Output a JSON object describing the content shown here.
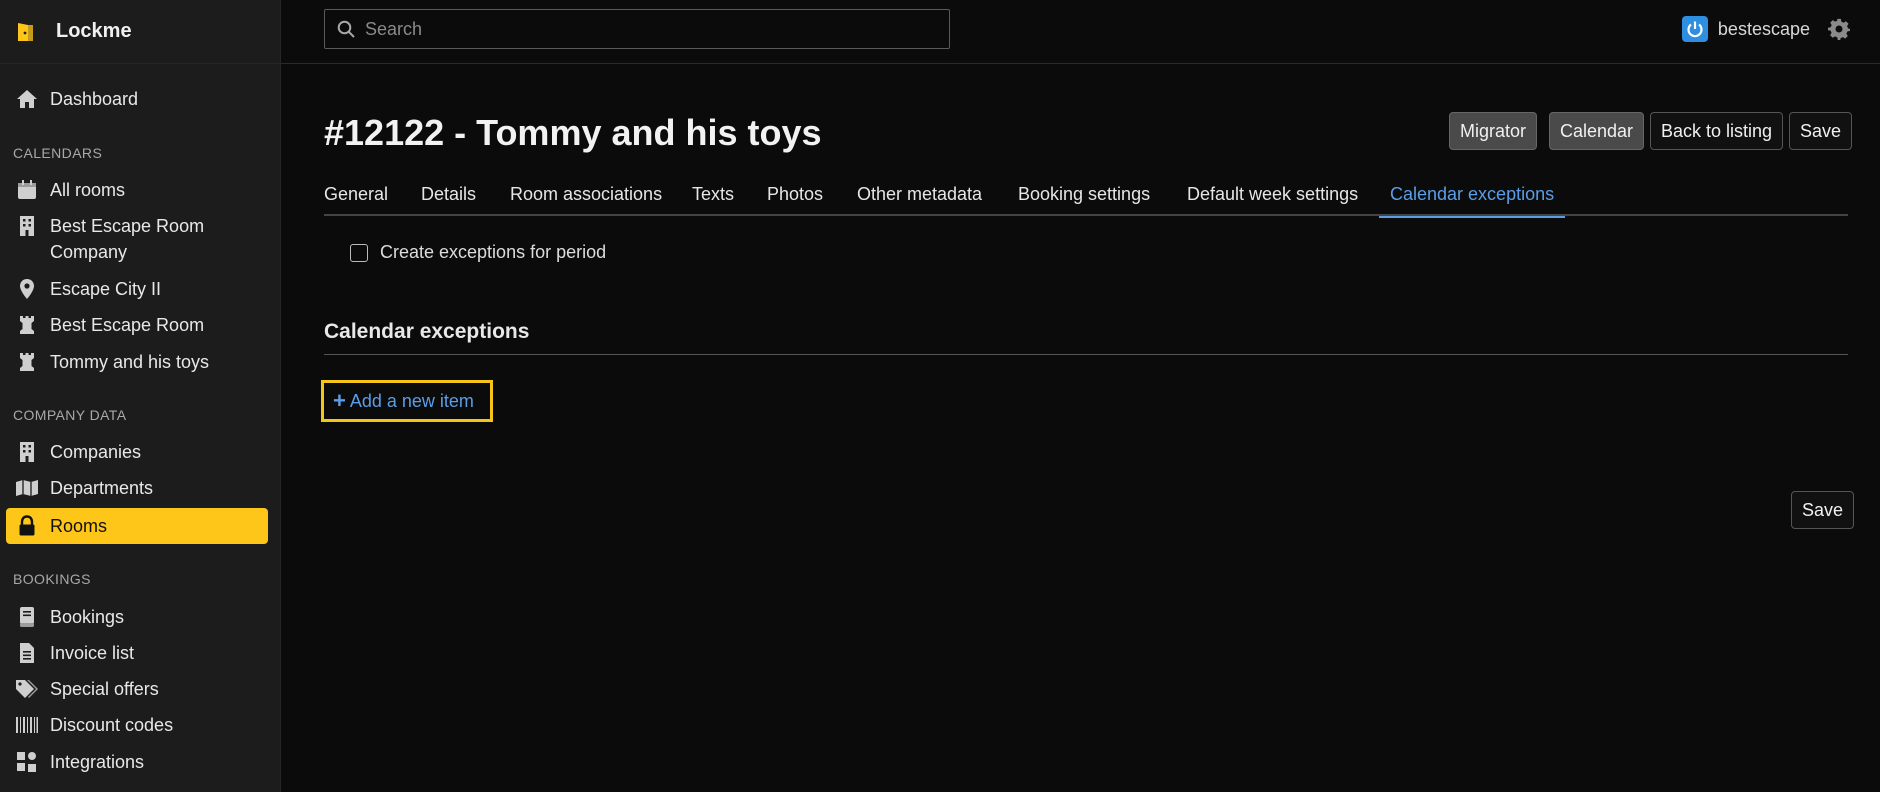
{
  "brand": {
    "name": "Lockme"
  },
  "sidebar": {
    "dashboard": "Dashboard",
    "sections": {
      "calendars": "CALENDARS",
      "company_data": "COMPANY DATA",
      "bookings": "BOOKINGS"
    },
    "calendars": [
      {
        "label": "All rooms",
        "icon": "calendar-icon"
      },
      {
        "label": "Best Escape Room Company",
        "icon": "building-icon"
      },
      {
        "label": "Escape City II",
        "icon": "map-pin-icon"
      },
      {
        "label": "Best Escape Room",
        "icon": "chess-rook-icon"
      },
      {
        "label": "Tommy and his toys",
        "icon": "chess-rook-icon"
      }
    ],
    "company_data": [
      {
        "label": "Companies",
        "icon": "building-icon"
      },
      {
        "label": "Departments",
        "icon": "map-icon"
      },
      {
        "label": "Rooms",
        "icon": "lock-icon",
        "active": true
      }
    ],
    "bookings": [
      {
        "label": "Bookings",
        "icon": "book-icon"
      },
      {
        "label": "Invoice list",
        "icon": "file-icon"
      },
      {
        "label": "Special offers",
        "icon": "tags-icon"
      },
      {
        "label": "Discount codes",
        "icon": "barcode-icon"
      },
      {
        "label": "Integrations",
        "icon": "puzzle-icon"
      }
    ]
  },
  "topbar": {
    "search_placeholder": "Search",
    "username": "bestescape"
  },
  "main": {
    "title": "#12122 - Tommy and his toys",
    "buttons": {
      "migrator": "Migrator",
      "calendar": "Calendar",
      "back": "Back to listing",
      "save": "Save"
    },
    "tabs": [
      "General",
      "Details",
      "Room associations",
      "Texts",
      "Photos",
      "Other metadata",
      "Booking settings",
      "Default week settings",
      "Calendar exceptions"
    ],
    "active_tab": "Calendar exceptions",
    "checkbox_label": "Create exceptions for period",
    "section_title": "Calendar exceptions",
    "add_item": "Add a new item",
    "bottom_save": "Save"
  },
  "colors": {
    "accent": "#ffc61a",
    "link": "#5a9ee8",
    "sidebar_bg": "#1c1c1c",
    "page_bg": "#0b0b0b"
  }
}
